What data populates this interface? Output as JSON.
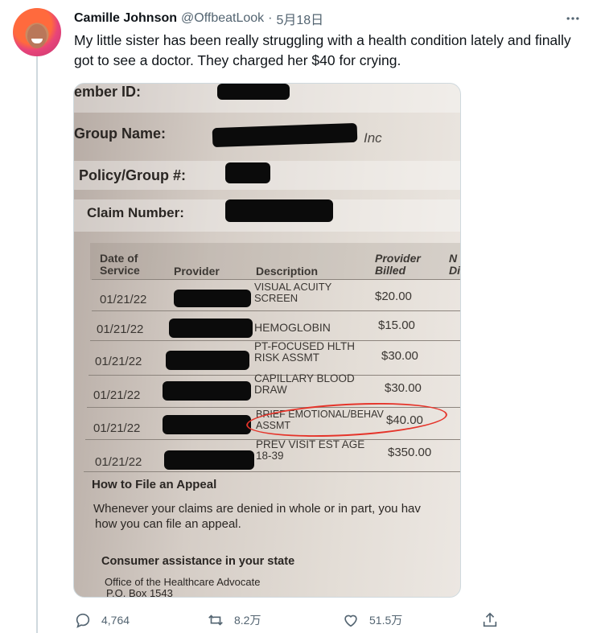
{
  "tweet": {
    "author_name": "Camille Johnson",
    "handle": "@OffbeatLook",
    "separator": "·",
    "date": "5月18日",
    "text": "My little sister has been really struggling with a health condition lately and finally got to see a doctor. They charged her $40 for crying."
  },
  "photo": {
    "member_id_label": "ember ID:",
    "group_name_label": "Group Name:",
    "group_suffix": "Inc",
    "policy_label": "Policy/Group #:",
    "claim_label": "Claim Number:",
    "columns": {
      "date_of_service": "Date of\nService",
      "provider": "Provider",
      "description": "Description",
      "provider_billed": "Provider\nBilled",
      "cut_col": "N\nDi"
    },
    "rows": [
      {
        "date": "01/21/22",
        "description": "VISUAL ACUITY\nSCREEN",
        "billed": "$20.00"
      },
      {
        "date": "01/21/22",
        "description": "HEMOGLOBIN",
        "billed": "$15.00"
      },
      {
        "date": "01/21/22",
        "description": "PT-FOCUSED HLTH\nRISK ASSMT",
        "billed": "$30.00"
      },
      {
        "date": "01/21/22",
        "description": "CAPILLARY BLOOD\nDRAW",
        "billed": "$30.00"
      },
      {
        "date": "01/21/22",
        "description": "BRIEF EMOTIONAL/BEHAV\nASSMT",
        "billed": "$40.00"
      },
      {
        "date": "01/21/22",
        "description": "PREV VISIT EST AGE\n18-39",
        "billed": "$350.00"
      }
    ],
    "appeal_heading": "How to File an Appeal",
    "appeal_text_1": "Whenever your claims are denied in whole or in part, you hav",
    "appeal_text_2": "how you can file an appeal.",
    "consumer_heading": "Consumer assistance in your state",
    "office_line": "Office of the Healthcare Advocate",
    "po_box": "P.O. Box 1543"
  },
  "actions": {
    "reply_count": "4,764",
    "retweet_count": "8.2万",
    "like_count": "51.5万"
  },
  "colors": {
    "accent_red_circle": "#e5342a",
    "secondary_text": "#536471",
    "thread_line": "#cfd9de"
  },
  "icons": {
    "more": "more-horizontal-icon",
    "reply": "reply-icon",
    "retweet": "retweet-icon",
    "like": "heart-icon",
    "share": "share-icon"
  }
}
